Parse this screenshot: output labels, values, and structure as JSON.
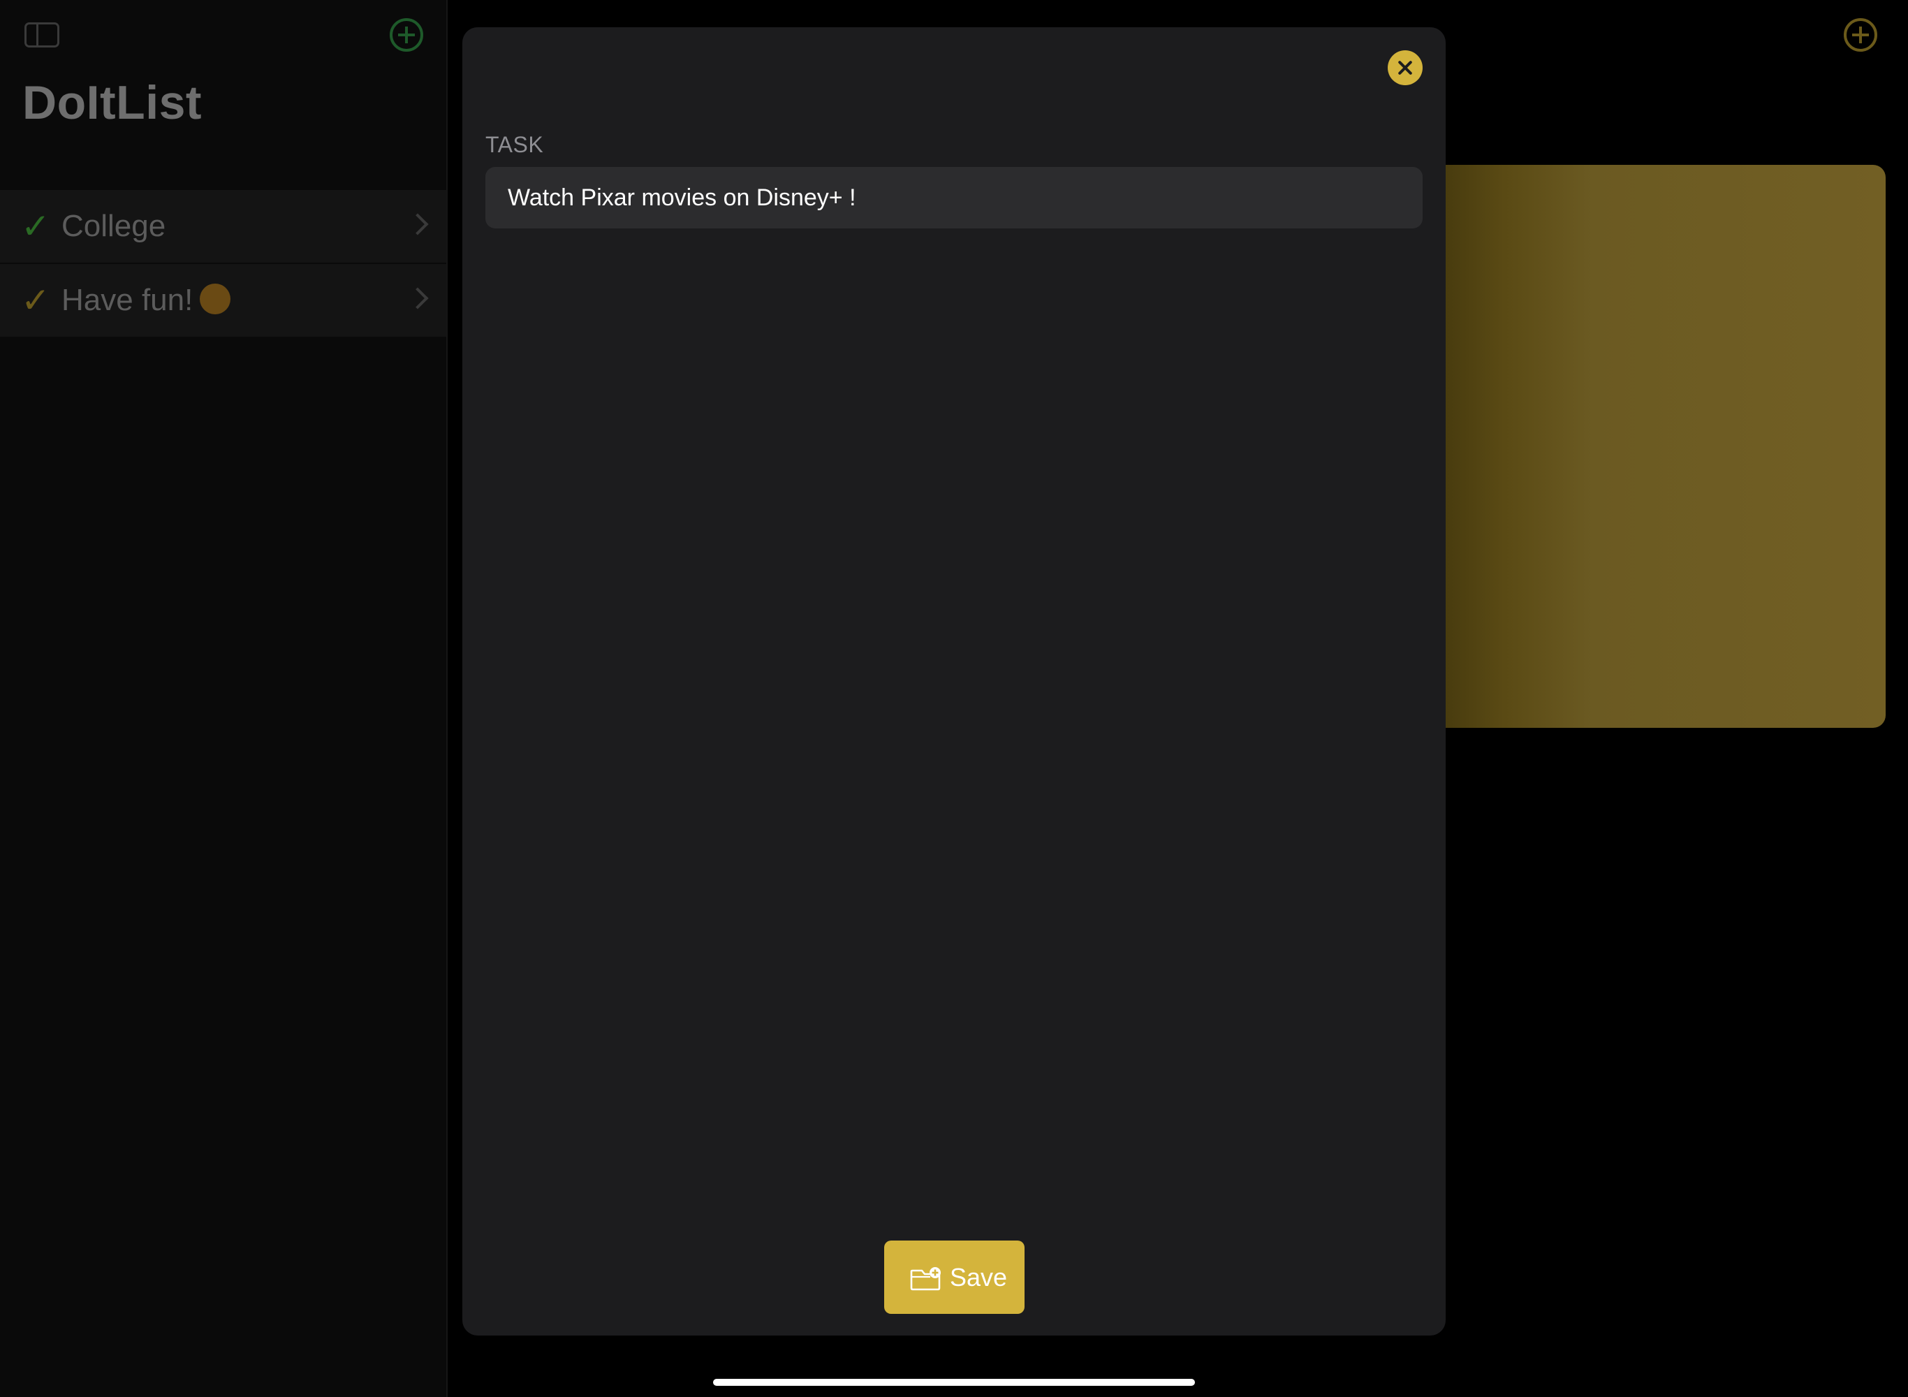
{
  "sidebar": {
    "title": "DoItList",
    "items": [
      {
        "label": "College",
        "check": "✓"
      },
      {
        "label": "Have fun!",
        "check": "✓",
        "emoji": "🥳"
      }
    ]
  },
  "sheet": {
    "section_label": "TASK",
    "task_value": "Watch Pixar movies on Disney+ !",
    "save_label": "Save"
  },
  "colors": {
    "accent": "#d4b43c",
    "sheet_background": "#1c1c1e",
    "field_background": "#2c2c2e",
    "sidebar_add": "#1e5a2a"
  },
  "icons": {
    "sidebar_toggle": "sidebar-toggle-icon",
    "sidebar_add": "plus-circle-icon",
    "detail_add": "plus-circle-icon",
    "close": "xmark-circle-icon",
    "save": "folder-badge-plus-icon",
    "chevron": "chevron-right-icon",
    "check": "checkmark-icon"
  }
}
